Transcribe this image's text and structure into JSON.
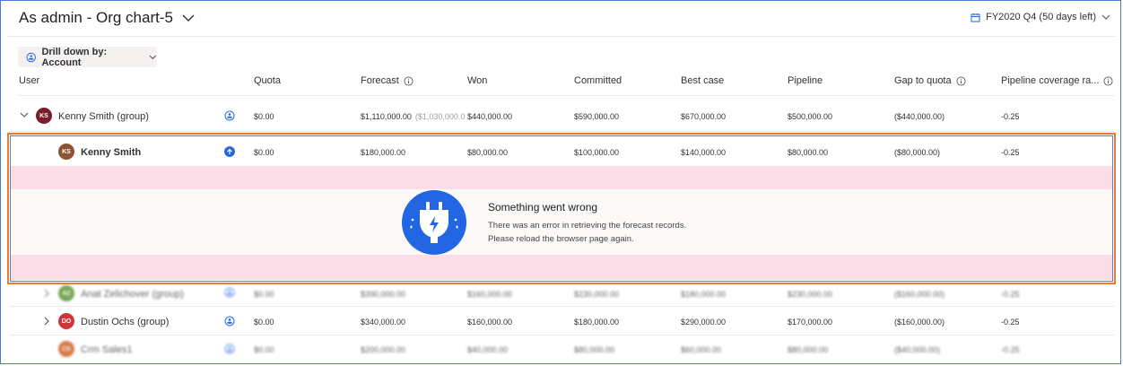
{
  "header": {
    "title": "As admin - Org chart-5",
    "period": "FY2020 Q4 (50 days left)"
  },
  "toolbar": {
    "drill_label": "Drill down by: Account"
  },
  "columns": {
    "user": "User",
    "quota": "Quota",
    "forecast": "Forecast",
    "won": "Won",
    "committed": "Committed",
    "best_case": "Best case",
    "pipeline": "Pipeline",
    "gap": "Gap to quota",
    "coverage": "Pipeline coverage ra..."
  },
  "rows": [
    {
      "name": "Kenny Smith (group)",
      "initials": "KS",
      "avatar_color": "#7a1e2b",
      "quota": "$0.00",
      "forecast": "$1,110,000.00",
      "forecast_prev": "($1,030,000.0",
      "won": "$440,000.00",
      "committed": "$590,000.00",
      "best_case": "$670,000.00",
      "pipeline": "$500,000.00",
      "gap": "($440,000.00)",
      "coverage": "-0.25"
    },
    {
      "name": "Kenny Smith",
      "initials": "KS",
      "avatar_color": "#8c5432",
      "quota": "$0.00",
      "forecast": "$180,000.00",
      "won": "$80,000.00",
      "committed": "$100,000.00",
      "best_case": "$140,000.00",
      "pipeline": "$80,000.00",
      "gap": "($80,000.00)",
      "coverage": "-0.25"
    },
    {
      "name": "Anat Zelichover (group)",
      "initials": "AZ",
      "avatar_color": "#4a8a1f",
      "quota": "$0.00",
      "forecast": "$390,000.00",
      "won": "$160,000.00",
      "committed": "$230,000.00",
      "best_case": "$180,000.00",
      "pipeline": "$230,000.00",
      "gap": "($160,000.00)",
      "coverage": "-0.25"
    },
    {
      "name": "Dustin Ochs (group)",
      "initials": "DO",
      "avatar_color": "#d13438",
      "quota": "$0.00",
      "forecast": "$340,000.00",
      "won": "$160,000.00",
      "committed": "$180,000.00",
      "best_case": "$290,000.00",
      "pipeline": "$170,000.00",
      "gap": "($160,000.00)",
      "coverage": "-0.25"
    },
    {
      "name": "Crm Sales1",
      "initials": "CS",
      "avatar_color": "#ca5010",
      "quota": "$0.00",
      "forecast": "$200,000.00",
      "won": "$40,000.00",
      "committed": "$80,000.00",
      "best_case": "$60,000.00",
      "pipeline": "$80,000.00",
      "gap": "($40,000.00)",
      "coverage": "-0.25"
    }
  ],
  "error": {
    "title": "Something went wrong",
    "line1": "There was an error in retrieving the forecast records.",
    "line2": "Please reload the browser page again."
  },
  "colors": {
    "accent": "#2266e3",
    "error_band": "#fadde6",
    "highlight": "#e87d2e"
  }
}
